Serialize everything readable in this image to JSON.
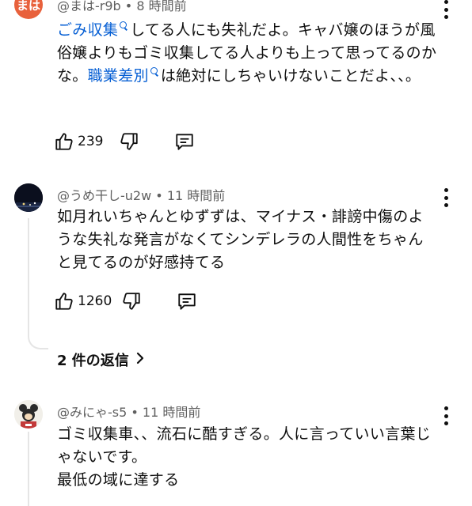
{
  "comments": [
    {
      "avatar_text": "まは",
      "avatar_color": "#e8613c",
      "handle": "@まは-r9b",
      "dot": "•",
      "time": "8 時間前",
      "segments": [
        {
          "text": "ごみ収集",
          "link": true
        },
        {
          "text": "してる人にも失礼だよ。キャバ嬢のほうが風俗嬢よりもゴミ収集してる人よりも上って思ってるのかな。",
          "link": false
        },
        {
          "text": "職業差別",
          "link": true
        },
        {
          "text": "は絶対にしちゃいけないことだよ、、。",
          "link": false
        }
      ],
      "likes": "239"
    },
    {
      "avatar_icon": "night-scene-avatar",
      "handle": "@うめ干し-u2w",
      "dot": "•",
      "time": "11 時間前",
      "text": "如月れいちゃんとゆずずは、マイナス・誹謗中傷のような失礼な発言がなくてシンデレラの人間性をちゃんと見てるのが好感持てる",
      "likes": "1260",
      "replies_label": "2 件の返信"
    },
    {
      "avatar_icon": "mascot-avatar",
      "handle": "@みにゃ-s5",
      "dot": "•",
      "time": "11 時間前",
      "text": "ゴミ収集車、、流石に酷すぎる。人に言っていい言葉じゃないです。",
      "text2": "最低の域に達する"
    }
  ],
  "colors": {
    "link": "#065fd4",
    "meta": "#606060",
    "text": "#0f0f0f",
    "thread": "#e5e5e5"
  }
}
